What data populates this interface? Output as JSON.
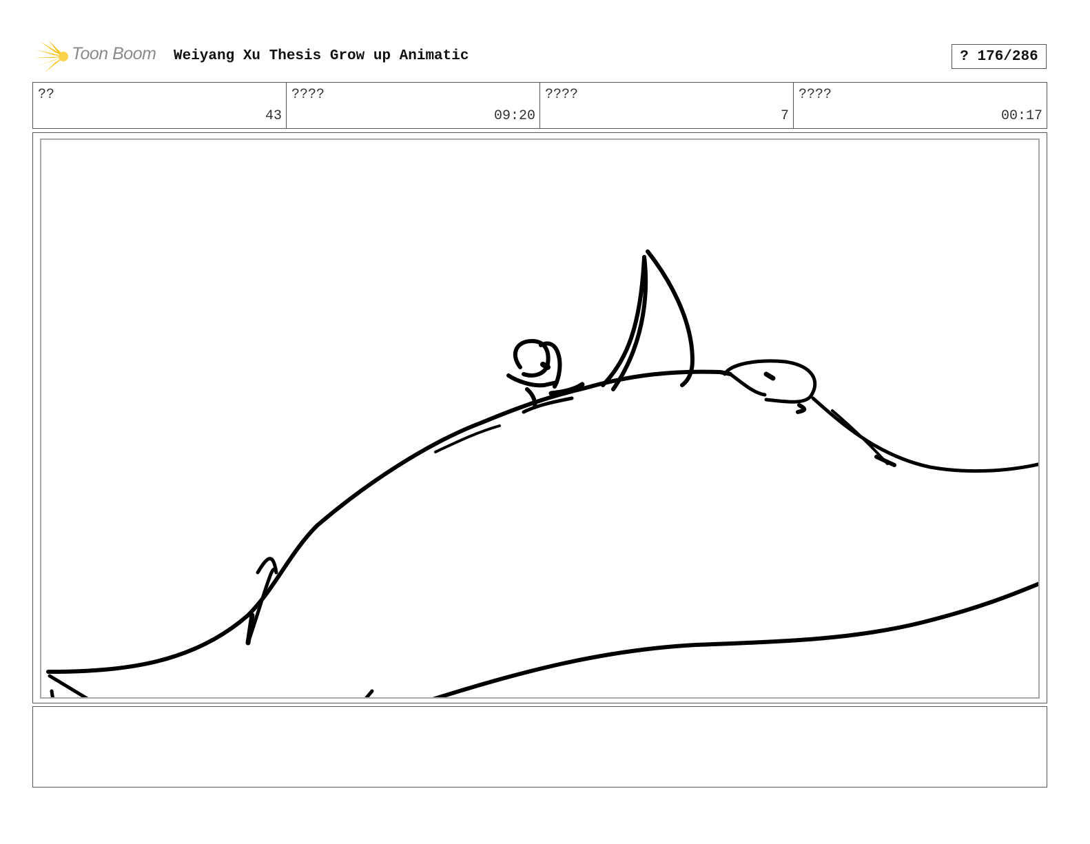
{
  "header": {
    "logo_text": "Toon Boom",
    "project_title": "Weiyang Xu Thesis Grow up Animatic",
    "page_counter": "? 176/286",
    "brand_color": "#f7c21a"
  },
  "info": [
    {
      "label": "??",
      "value": "43"
    },
    {
      "label": "????",
      "value": "09:20"
    },
    {
      "label": "????",
      "value": "7"
    },
    {
      "label": "????",
      "value": "00:17"
    }
  ],
  "panel": {
    "image": "black-ink-sketch-of-creature-back-with-small-figure-riding"
  },
  "notes": {
    "text": ""
  }
}
